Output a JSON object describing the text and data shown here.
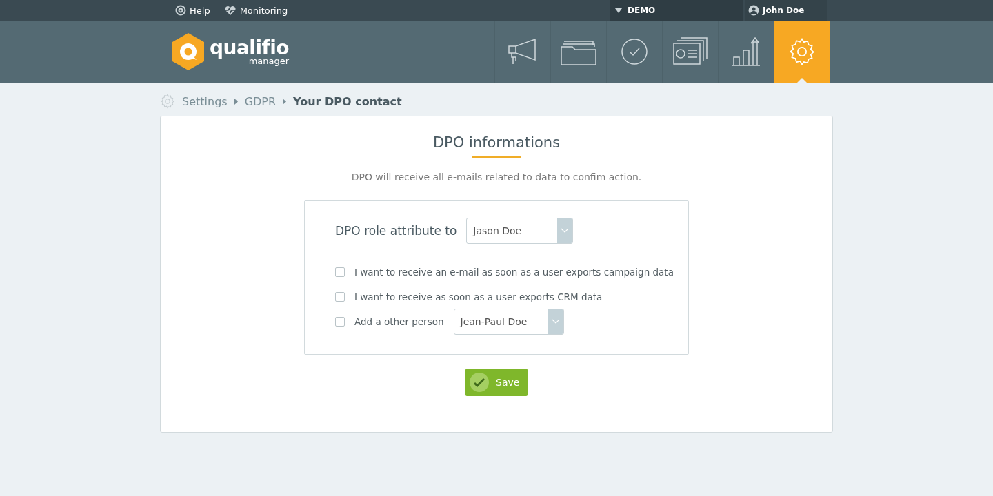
{
  "top_bar": {
    "links": [
      {
        "kind": "help",
        "label": "Help"
      },
      {
        "kind": "monitoring",
        "label": "Monitoring"
      }
    ],
    "account": {
      "label": "DEMO"
    },
    "user": {
      "name": "John Doe"
    }
  },
  "header": {
    "logo": {
      "name": "qualifio",
      "subtitle": "manager"
    },
    "nav": [
      {
        "kind": "megaphone",
        "selected": false
      },
      {
        "kind": "folder",
        "selected": false
      },
      {
        "kind": "check",
        "selected": false
      },
      {
        "kind": "cards",
        "selected": false
      },
      {
        "kind": "chart",
        "selected": false
      },
      {
        "kind": "gear",
        "selected": true
      }
    ]
  },
  "breadcrumb": [
    "Settings",
    "GDPR",
    "Your DPO contact"
  ],
  "card": {
    "title": "DPO informations",
    "description": "DPO will receive all e-mails related to data to confim action.",
    "role": {
      "label": "DPO role attribute to",
      "value": "Jason Doe"
    },
    "options": [
      {
        "kind": "checkbox",
        "label": "I want to receive an e-mail as soon as a user exports campaign data",
        "checked": false
      },
      {
        "kind": "checkbox",
        "label": "I want to receive as soon as a user exports CRM data",
        "checked": false
      },
      {
        "kind": "checkbox-select",
        "label": "Add a other person",
        "checked": false,
        "value": "Jean-Paul Doe"
      }
    ],
    "save": {
      "label": "Save"
    }
  }
}
